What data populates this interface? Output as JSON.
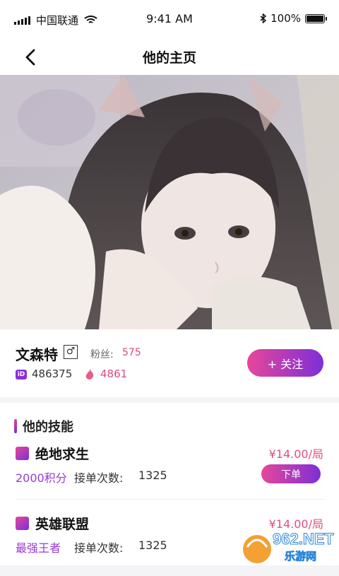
{
  "status": {
    "carrier": "中国联通",
    "time": "9:41 AM",
    "battery": "100%"
  },
  "nav": {
    "title": "他的主页",
    "back": "back"
  },
  "profile": {
    "name": "文森特",
    "gender_icon": "male-icon",
    "fans_label": "粉丝:",
    "fans": "575",
    "id_badge": "iD",
    "id": "486375",
    "heat": "4861",
    "follow_label": "+ 关注"
  },
  "skills": {
    "title": "他的技能",
    "items": [
      {
        "name": "绝地求生",
        "price": "¥14.00/局",
        "level": "2000积分",
        "orders_label": "接单次数:",
        "orders": "1325",
        "button": "下单"
      },
      {
        "name": "英雄联盟",
        "price": "¥14.00/局",
        "level": "最强王者",
        "orders_label": "接单次数:",
        "orders": "1325"
      }
    ]
  },
  "watermark": {
    "text": "962.NET",
    "sub": "乐游网"
  },
  "colors": {
    "accent_pink": "#e6479a",
    "accent_purple": "#7d2fd8",
    "price_red": "#e34d7f"
  }
}
